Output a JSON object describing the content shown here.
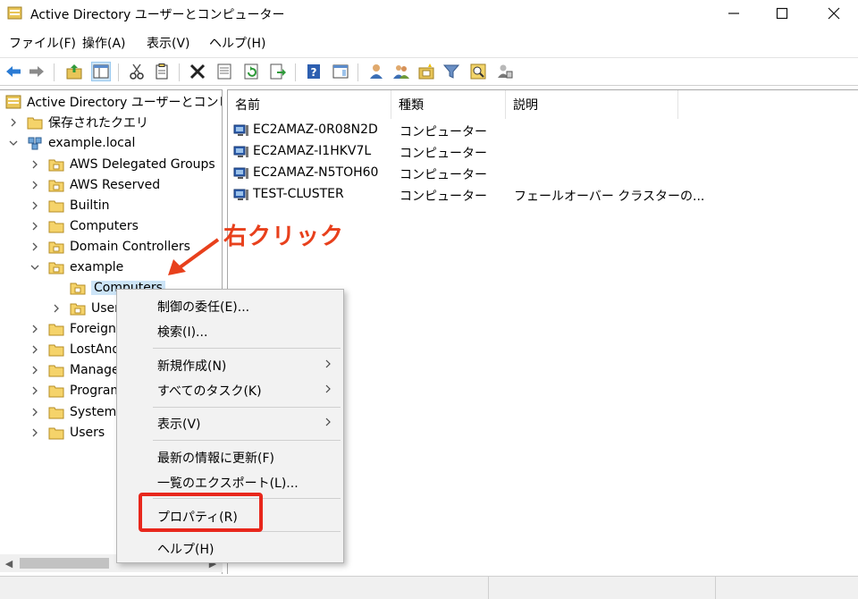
{
  "window": {
    "title": "Active Directory ユーザーとコンピューター",
    "minimize_icon": "minimize-icon",
    "maximize_icon": "maximize-icon",
    "close_icon": "close-icon"
  },
  "menu": [
    "ファイル(F)",
    "操作(A)",
    "表示(V)",
    "ヘルプ(H)"
  ],
  "toolbar": [
    "back-icon",
    "forward-icon",
    "up-folder-icon",
    "show-hide-tree-icon",
    "cut-icon",
    "copy-icon",
    "delete-icon",
    "properties-icon",
    "refresh-icon",
    "export-icon",
    "help-icon",
    "console-tree-icon",
    "new-user-icon",
    "new-group-icon",
    "new-ou-icon",
    "filter-icon",
    "find-icon",
    "delegate-icon"
  ],
  "tree": {
    "root": "Active Directory ユーザーとコンピュー",
    "items": [
      {
        "label": "保存されたクエリ",
        "expanded": false
      },
      {
        "label": "example.local",
        "expanded": true
      },
      {
        "label": "AWS Delegated Groups",
        "expanded": false
      },
      {
        "label": "AWS Reserved",
        "expanded": false
      },
      {
        "label": "Builtin",
        "expanded": false
      },
      {
        "label": "Computers",
        "expanded": false
      },
      {
        "label": "Domain Controllers",
        "expanded": false
      },
      {
        "label": "example",
        "expanded": true
      },
      {
        "label": "Computers",
        "selected": true
      },
      {
        "label": "Users",
        "expanded": false
      },
      {
        "label": "ForeignSecurityPrincipals",
        "expanded": false
      },
      {
        "label": "LostAndFound",
        "expanded": false
      },
      {
        "label": "Managed Service Accounts",
        "expanded": false
      },
      {
        "label": "Program Data",
        "expanded": false
      },
      {
        "label": "System",
        "expanded": false
      },
      {
        "label": "Users",
        "expanded": false
      }
    ]
  },
  "list": {
    "columns": [
      "名前",
      "種類",
      "説明"
    ],
    "rows": [
      {
        "name": "EC2AMAZ-0R08N2D",
        "type": "コンピューター",
        "desc": ""
      },
      {
        "name": "EC2AMAZ-I1HKV7L",
        "type": "コンピューター",
        "desc": ""
      },
      {
        "name": "EC2AMAZ-N5TOH60",
        "type": "コンピューター",
        "desc": ""
      },
      {
        "name": "TEST-CLUSTER",
        "type": "コンピューター",
        "desc": "フェールオーバー クラスターの..."
      }
    ]
  },
  "context_menu": [
    {
      "label": "制御の委任(E)..."
    },
    {
      "label": "検索(I)..."
    },
    {
      "label": "新規作成(N)",
      "submenu": true
    },
    {
      "label": "すべてのタスク(K)",
      "submenu": true
    },
    {
      "label": "表示(V)",
      "submenu": true
    },
    {
      "label": "最新の情報に更新(F)"
    },
    {
      "label": "一覧のエクスポート(L)..."
    },
    {
      "label": "プロパティ(R)"
    },
    {
      "label": "ヘルプ(H)"
    }
  ],
  "annotation": {
    "label": "右クリック",
    "color": "#e8401c"
  }
}
